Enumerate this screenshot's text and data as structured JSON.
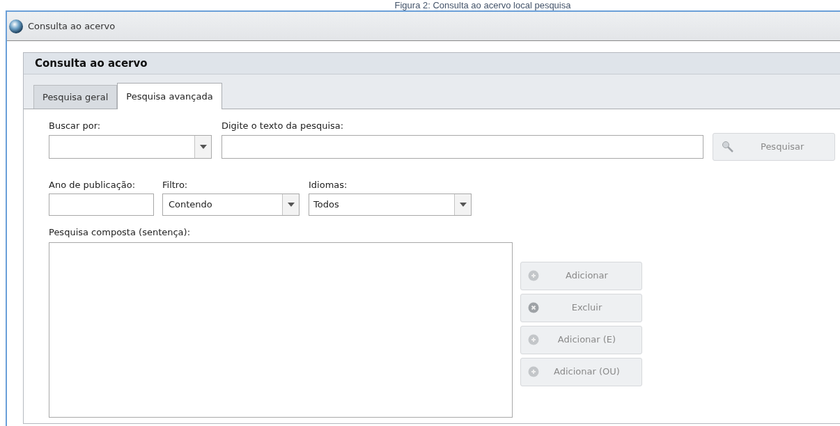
{
  "caption": "Figura 2: Consulta ao acervo local pesquisa",
  "window": {
    "title": "Consulta ao acervo"
  },
  "panel": {
    "title": "Consulta ao acervo"
  },
  "tabs": [
    {
      "label": "Pesquisa geral",
      "selected": false
    },
    {
      "label": "Pesquisa avançada",
      "selected": true
    }
  ],
  "search_row": {
    "buscar_label": "Buscar por:",
    "texto_label": "Digite o texto da pesquisa:",
    "search_button": {
      "label": "Pesquisar",
      "disabled": true
    }
  },
  "filter_row": {
    "ano_label": "Ano de publicação:",
    "filtro_label": "Filtro:",
    "filtro_value": "Contendo",
    "idiomas_label": "Idiomas:",
    "idiomas_value": "Todos"
  },
  "composite": {
    "label": "Pesquisa composta (sentença):",
    "buttons": [
      {
        "label": "Adicionar",
        "kind": "plus",
        "disabled": true
      },
      {
        "label": "Excluir",
        "kind": "remove",
        "disabled": true
      },
      {
        "label": "Adicionar (E)",
        "kind": "plus",
        "disabled": true
      },
      {
        "label": "Adicionar (OU)",
        "kind": "plus",
        "disabled": true
      }
    ]
  }
}
